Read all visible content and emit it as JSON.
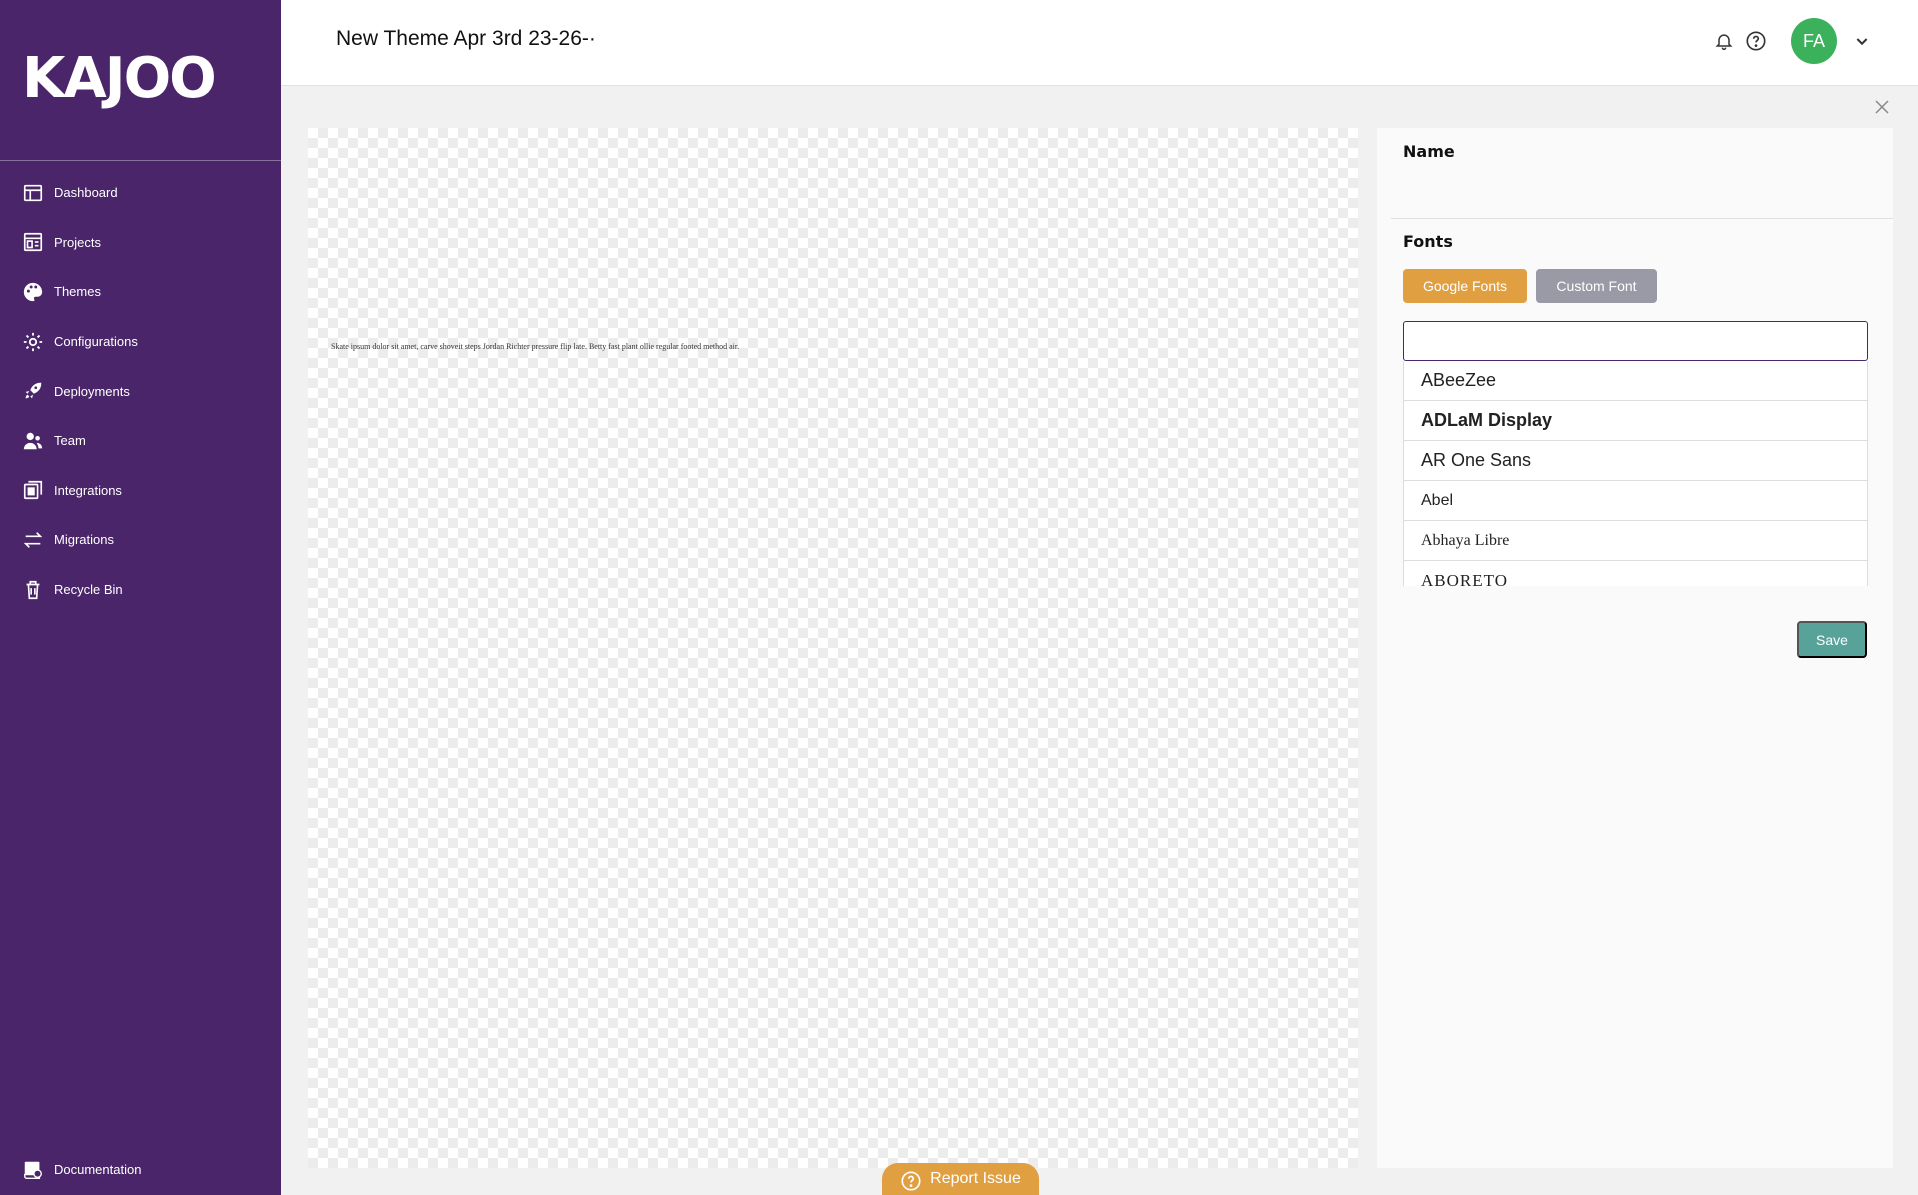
{
  "brand": {
    "name": "KAJOO"
  },
  "sidebar": {
    "items": [
      {
        "label": "Dashboard"
      },
      {
        "label": "Projects"
      },
      {
        "label": "Themes"
      },
      {
        "label": "Configurations"
      },
      {
        "label": "Deployments"
      },
      {
        "label": "Team"
      },
      {
        "label": "Integrations"
      },
      {
        "label": "Migrations"
      },
      {
        "label": "Recycle Bin"
      }
    ],
    "footer": {
      "label": "Documentation"
    }
  },
  "header": {
    "title": "New Theme Apr 3rd 23-26-·",
    "avatar_initials": "FA"
  },
  "preview": {
    "sample_text": "Skate ipsum dolor sit amet, carve shoveit steps Jordan Richter pressure flip late. Betty fast plant ollie regular footed method air."
  },
  "panel": {
    "name_label": "Name",
    "fonts_label": "Fonts",
    "google_fonts_button": "Google Fonts",
    "custom_font_button": "Custom Font",
    "search_value": "",
    "font_options": [
      "ABeeZee",
      "ADLaM Display",
      "AR One Sans",
      "Abel",
      "Abhaya Libre",
      "ABORETO"
    ],
    "save_button": "Save"
  },
  "report_issue": {
    "label": "Report Issue"
  },
  "colors": {
    "sidebar": "#4a2569",
    "google_button": "#e0a041",
    "custom_button": "#9a9aa6",
    "save_button": "#57a39a",
    "avatar": "#3cb15c"
  }
}
